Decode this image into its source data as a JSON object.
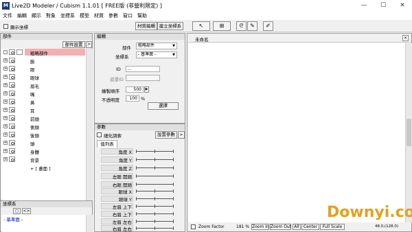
{
  "window": {
    "title": "Live2D Modeler / Cubism 1.1.01 [ FREE版 (非營利限定) ]"
  },
  "menu": [
    "文件",
    "編輯",
    "顯示",
    "對象",
    "坐標系",
    "模型",
    "材質",
    "參數",
    "窗口",
    "幫助"
  ],
  "toolbar": {
    "show_coords_label": "顯示坐標",
    "texture_edit": "材質編輯",
    "build_coords": "建立坐標系"
  },
  "parts_panel": {
    "title": "部件",
    "settings_btn": "部件設置",
    "items": [
      "粗略部件",
      "臉",
      "眼",
      "眼球",
      "眉毛",
      "嘴",
      "鼻",
      "耳",
      "前頭",
      "側頭",
      "後頭",
      "頭",
      "身體",
      "背景",
      "+ [ 畫面 ]"
    ]
  },
  "coords_panel": {
    "title": "坐標系",
    "items": [
      "- 基準面 -"
    ]
  },
  "edit_panel": {
    "title": "編輯",
    "part_label": "部件",
    "part_value": "粗略部件",
    "coord_label": "坐標系",
    "coord_value": "- 基準面 -",
    "id_label": "ID",
    "id_value": "...",
    "clipping_label": "遮罩ID",
    "draw_order_label": "繪製順序",
    "draw_order_value": "500",
    "opacity_label": "不透明度",
    "opacity_value": "100",
    "opacity_unit": "%",
    "select_btn": "選擇"
  },
  "params_panel": {
    "title": "參數",
    "detail_label": "細化調索",
    "settings_btn": "設置參數",
    "tab": "值列表",
    "items": [
      "角度 X",
      "角度 Y",
      "角度 Z",
      "左眼 開閉",
      "右眼 開閉",
      "眼球 X",
      "眼球 Y",
      "左眉 上下",
      "右眉 上下",
      "左眉 左右",
      "右眉 左右"
    ]
  },
  "canvas": {
    "tab": "未命名"
  },
  "statusbar": {
    "zoom_factor_label": "Zoom Factor",
    "zoom_value": "181 %",
    "zoom_in": "Zoom In",
    "zoom_out": "Zoom Out",
    "all": "All",
    "center": "Center",
    "full_scale": "Full Scale",
    "coords": "48.0,(128.0)"
  },
  "watermark": "Downyi.com",
  "colors": {
    "selected_row": "#f4b0b0",
    "accent_blue": "#0000cc",
    "watermark": "#e6a020"
  }
}
